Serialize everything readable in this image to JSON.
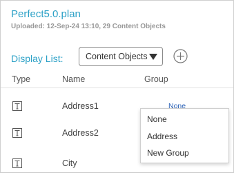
{
  "plan": {
    "title": "Perfect5.0.plan",
    "upload_info": "Uploaded: 12-Sep-24 13:10, 29 Content Objects"
  },
  "display_list": {
    "label": "Display List:",
    "selected": "Content Objects"
  },
  "table": {
    "headers": {
      "type": "Type",
      "name": "Name",
      "group": "Group"
    },
    "rows": [
      {
        "icon": "text-type-icon",
        "name": "Address1",
        "group": "None"
      },
      {
        "icon": "text-type-icon",
        "name": "Address2"
      },
      {
        "icon": "text-type-icon",
        "name": "City"
      }
    ]
  },
  "group_menu": {
    "options": [
      "None",
      "Address",
      "New Group"
    ]
  },
  "colors": {
    "accent": "#2aa0c6",
    "link": "#2b62b8",
    "border": "#cfcfcf"
  },
  "icons": {
    "dropdown": "caret-down-icon",
    "add": "plus-circle-icon",
    "row_type": "text-type-icon"
  }
}
